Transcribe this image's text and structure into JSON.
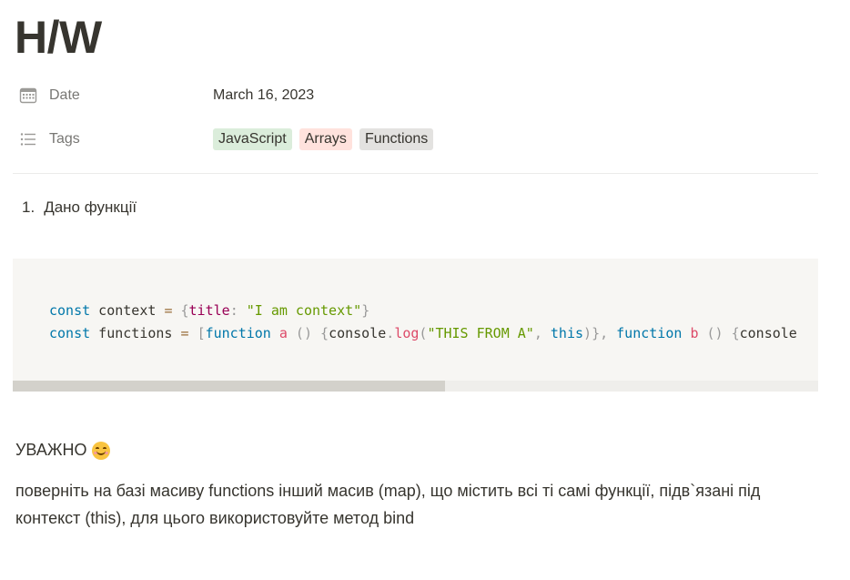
{
  "page": {
    "title": "H/W"
  },
  "properties": {
    "date": {
      "icon": "calendar-icon",
      "name": "Date",
      "value": "March 16, 2023"
    },
    "tags": {
      "icon": "list-icon",
      "name": "Tags",
      "items": [
        {
          "label": "JavaScript",
          "color": "#dbeddb"
        },
        {
          "label": "Arrays",
          "color": "#ffe2dd"
        },
        {
          "label": "Functions",
          "color": "#e3e2e0"
        }
      ]
    }
  },
  "content": {
    "list_item": {
      "number": "1.",
      "text": "Дано функції"
    },
    "code": {
      "line1": {
        "kw_const": "const",
        "name": " context ",
        "eq": "=",
        "sp": " ",
        "open": "{",
        "prop": "title",
        "colon": ": ",
        "str": "\"I am context\"",
        "close": "}"
      },
      "line2": {
        "kw_const": "const",
        "name": " functions ",
        "eq": "=",
        "sp": " ",
        "bracket": "[",
        "kw_function1": "function",
        "sp2": " ",
        "fn_a": "a",
        "parens1": " () ",
        "brace1": "{",
        "console1": "console",
        "dot1": ".",
        "log1": "log",
        "paren_open1": "(",
        "str1": "\"THIS FROM A\"",
        "comma1": ", ",
        "this1": "this",
        "paren_close1": ")",
        "brace_close1": "}",
        "comma2": ", ",
        "kw_function2": "function",
        "sp3": " ",
        "fn_b": "b",
        "parens2": " () ",
        "brace2": "{",
        "console2": "console"
      }
    },
    "heading": "УВАЖНО",
    "heading_emoji": "smiling-face-icon",
    "paragraph": "поверніть на базі масиву functions інший масив (map), що містить всі ті самі функції, підв`язані під контекст (this), для цього використовуйте метод bind"
  }
}
